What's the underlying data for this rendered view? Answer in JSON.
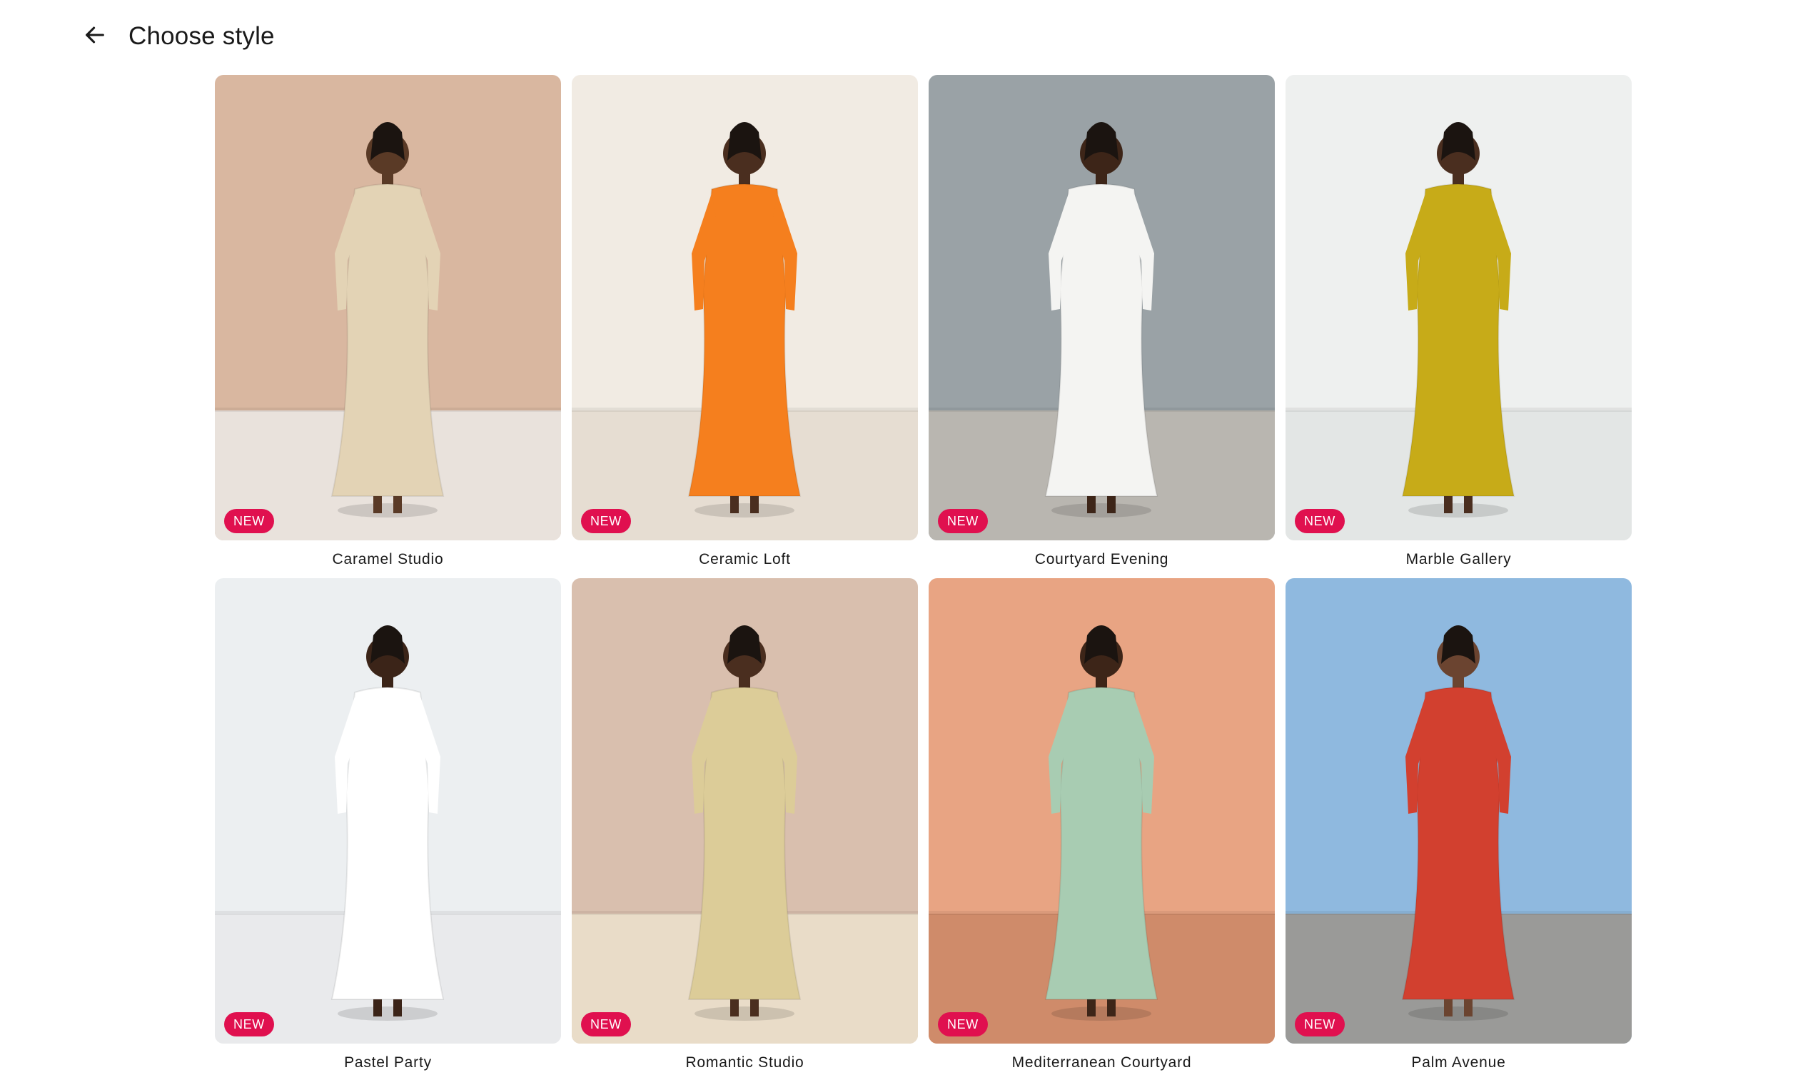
{
  "header": {
    "title": "Choose style",
    "back_icon": "arrow-left-icon"
  },
  "badge_text": "NEW",
  "styles": [
    {
      "label": "Caramel Studio",
      "badge": "NEW",
      "bg": "#d9b7a0",
      "floor": "#e9e2dc",
      "outfit": "#e3d3b5",
      "skin": "#5a3a26"
    },
    {
      "label": "Ceramic Loft",
      "badge": "NEW",
      "bg": "#f1ebe3",
      "floor": "#e6ddd2",
      "outfit": "#f57f1e",
      "skin": "#4a2e1f"
    },
    {
      "label": "Courtyard Evening",
      "badge": "NEW",
      "bg": "#9aa2a6",
      "floor": "#b9b6b0",
      "outfit": "#f4f4f2",
      "skin": "#3d2518"
    },
    {
      "label": "Marble Gallery",
      "badge": "NEW",
      "bg": "#eef0ef",
      "floor": "#e3e6e5",
      "outfit": "#c7ab18",
      "skin": "#4a2e1f"
    },
    {
      "label": "Pastel Party",
      "badge": "NEW",
      "bg": "#eceff1",
      "floor": "#e9eaec",
      "outfit": "#ffffff",
      "skin": "#3b2418"
    },
    {
      "label": "Romantic Studio",
      "badge": "NEW",
      "bg": "#d9bfae",
      "floor": "#e9dcc8",
      "outfit": "#dccc98",
      "skin": "#4a2e1f"
    },
    {
      "label": "Mediterranean Courtyard",
      "badge": "NEW",
      "bg": "#e8a483",
      "floor": "#cf8b6a",
      "outfit": "#a8ccb2",
      "skin": "#3d2518"
    },
    {
      "label": "Palm Avenue",
      "badge": "NEW",
      "bg": "#8fb9df",
      "floor": "#9a9a98",
      "outfit": "#d2402f",
      "skin": "#6b4430"
    }
  ]
}
